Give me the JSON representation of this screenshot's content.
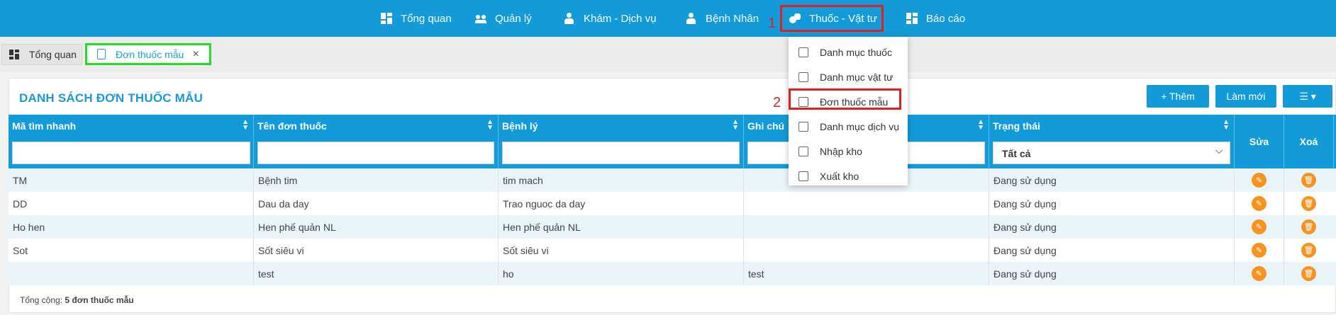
{
  "nav": {
    "items": [
      {
        "label": "Tổng quan",
        "icon": "dashboard-icon"
      },
      {
        "label": "Quản lý",
        "icon": "people-icon"
      },
      {
        "label": "Khám - Dịch vụ",
        "icon": "doctor-icon"
      },
      {
        "label": "Bệnh Nhân",
        "icon": "patient-icon"
      },
      {
        "label": "Thuốc - Vật tư",
        "icon": "pills-icon"
      },
      {
        "label": "Báo cáo",
        "icon": "report-icon"
      }
    ],
    "step1": "1",
    "step2": "2"
  },
  "tabs": {
    "home": "Tổng quan",
    "active": "Đơn thuốc mẫu",
    "close": "×"
  },
  "dropdown": {
    "items": [
      "Danh mục thuốc",
      "Danh mục vật tư",
      "Đơn thuốc mẫu",
      "Danh mục dịch vụ",
      "Nhập kho",
      "Xuất kho"
    ]
  },
  "panel": {
    "title": "DANH SÁCH ĐƠN THUỐC MẪU",
    "add_button": "+ Thêm",
    "refresh_button": "Làm mới",
    "columns_button": "☰ ▾"
  },
  "table": {
    "headers": [
      "Mã tìm nhanh",
      "Tên đơn thuốc",
      "Bệnh lý",
      "Ghi chú",
      "Trạng thái",
      "Sửa",
      "Xoá"
    ],
    "status_filter": "Tất cả",
    "rows": [
      {
        "code": "TM",
        "name": "Bệnh tim",
        "disease": "tim mach",
        "note": "",
        "status": "Đang sử dụng"
      },
      {
        "code": "DD",
        "name": "Dau da day",
        "disease": "Trao nguoc da day",
        "note": "",
        "status": "Đang sử dụng"
      },
      {
        "code": "Ho hen",
        "name": "Hen phế quản NL",
        "disease": "Hen phế quản NL",
        "note": "",
        "status": "Đang sử dụng"
      },
      {
        "code": "Sot",
        "name": "Sốt siêu vi",
        "disease": "Sốt siêu vi",
        "note": "",
        "status": "Đang sử dụng"
      },
      {
        "code": "",
        "name": "test",
        "disease": "ho",
        "note": "test",
        "status": "Đang sử dụng"
      }
    ]
  },
  "footer": {
    "total_label": "Tổng cộng:",
    "total_value": "5 đơn thuốc mẫu"
  },
  "colors": {
    "primary": "#129bd8",
    "highlight_red": "#e02020",
    "highlight_green": "#22dd22",
    "action_orange": "#f7931e"
  }
}
